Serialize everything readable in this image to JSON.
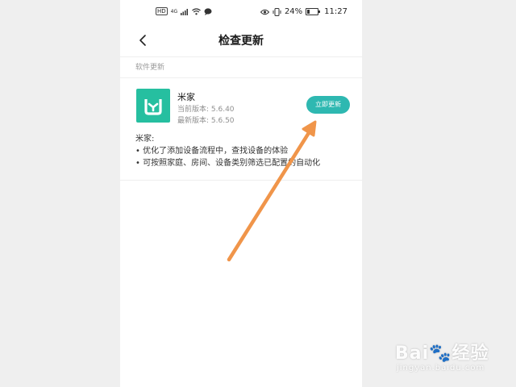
{
  "status_bar": {
    "hd_badge": "HD",
    "network_badge": "4G",
    "battery_percent": "24%",
    "battery_level": 0.24,
    "time": "11:27",
    "icons": [
      "signal-icon",
      "wifi-icon",
      "chat-bubble-icon",
      "eye-icon",
      "vibrate-icon",
      "battery-icon"
    ]
  },
  "header": {
    "title": "检查更新",
    "back_icon": "chevron-left-icon"
  },
  "section": {
    "label": "软件更新"
  },
  "app": {
    "name": "米家",
    "current_version": "当前版本: 5.6.40",
    "latest_version": "最新版本: 5.6.50",
    "update_button": "立即更新",
    "icon_color": "#26bfa0",
    "button_color": "#2eb8b1",
    "notes_title": "米家:",
    "notes": [
      "• 优化了添加设备流程中，查找设备的体验",
      "• 可按照家庭、房间、设备类别筛选已配置的自动化"
    ]
  },
  "annotation": {
    "arrow_color": "#f0954a"
  },
  "watermark": {
    "main": "Bai🐾经验",
    "sub": "jingyan.baidu.com"
  }
}
